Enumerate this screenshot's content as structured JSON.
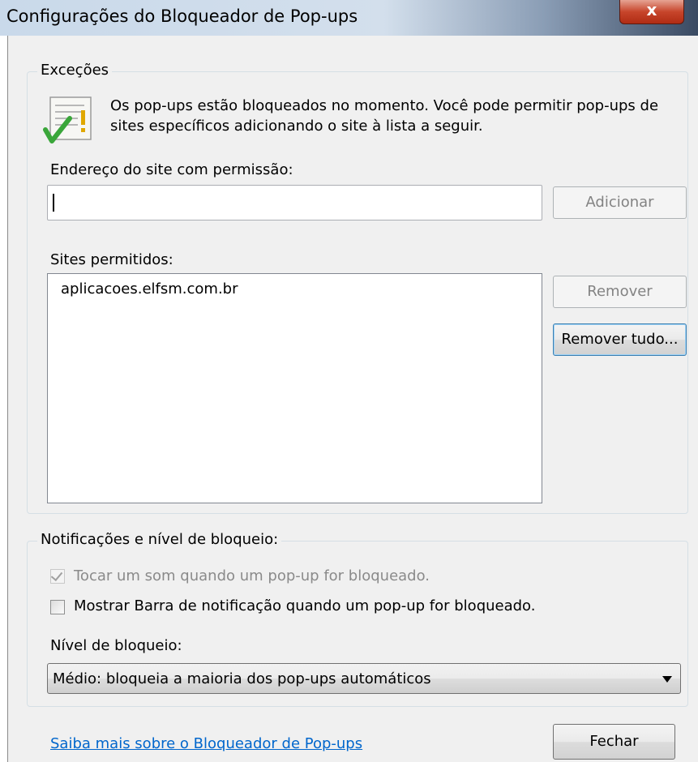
{
  "window": {
    "title": "Configurações do Bloqueador de Pop-ups",
    "close_label": "x"
  },
  "exceptions": {
    "group_label": "Exceções",
    "info_text": "Os pop-ups estão bloqueados no momento. Você pode permitir pop-ups de sites específicos adicionando o site à lista a seguir.",
    "address_label": "Endereço do site com permissão:",
    "address_value": "",
    "add_button": "Adicionar",
    "allowed_label": "Sites permitidos:",
    "allowed_sites": [
      "aplicacoes.elfsm.com.br"
    ],
    "remove_button": "Remover",
    "remove_all_button": "Remover tudo..."
  },
  "notifications": {
    "group_label": "Notificações e nível de bloqueio:",
    "play_sound_label": "Tocar um som quando um pop-up for bloqueado.",
    "play_sound_checked": true,
    "show_bar_label": "Mostrar Barra de notificação quando um pop-up for bloqueado.",
    "show_bar_checked": false,
    "level_label": "Nível de bloqueio:",
    "level_value": "Médio: bloqueia a maioria dos pop-ups automáticos"
  },
  "footer": {
    "learn_more_link": "Saiba mais sobre o Bloqueador de Pop-ups",
    "close_button": "Fechar"
  },
  "icons": [
    "info-list-icon",
    "check-icon",
    "dropdown-arrow-icon"
  ],
  "colors": {
    "link": "#0066cc",
    "close_button": "#c7452b",
    "check_icon": "#3aa63a",
    "warning_mark": "#e0a800"
  }
}
